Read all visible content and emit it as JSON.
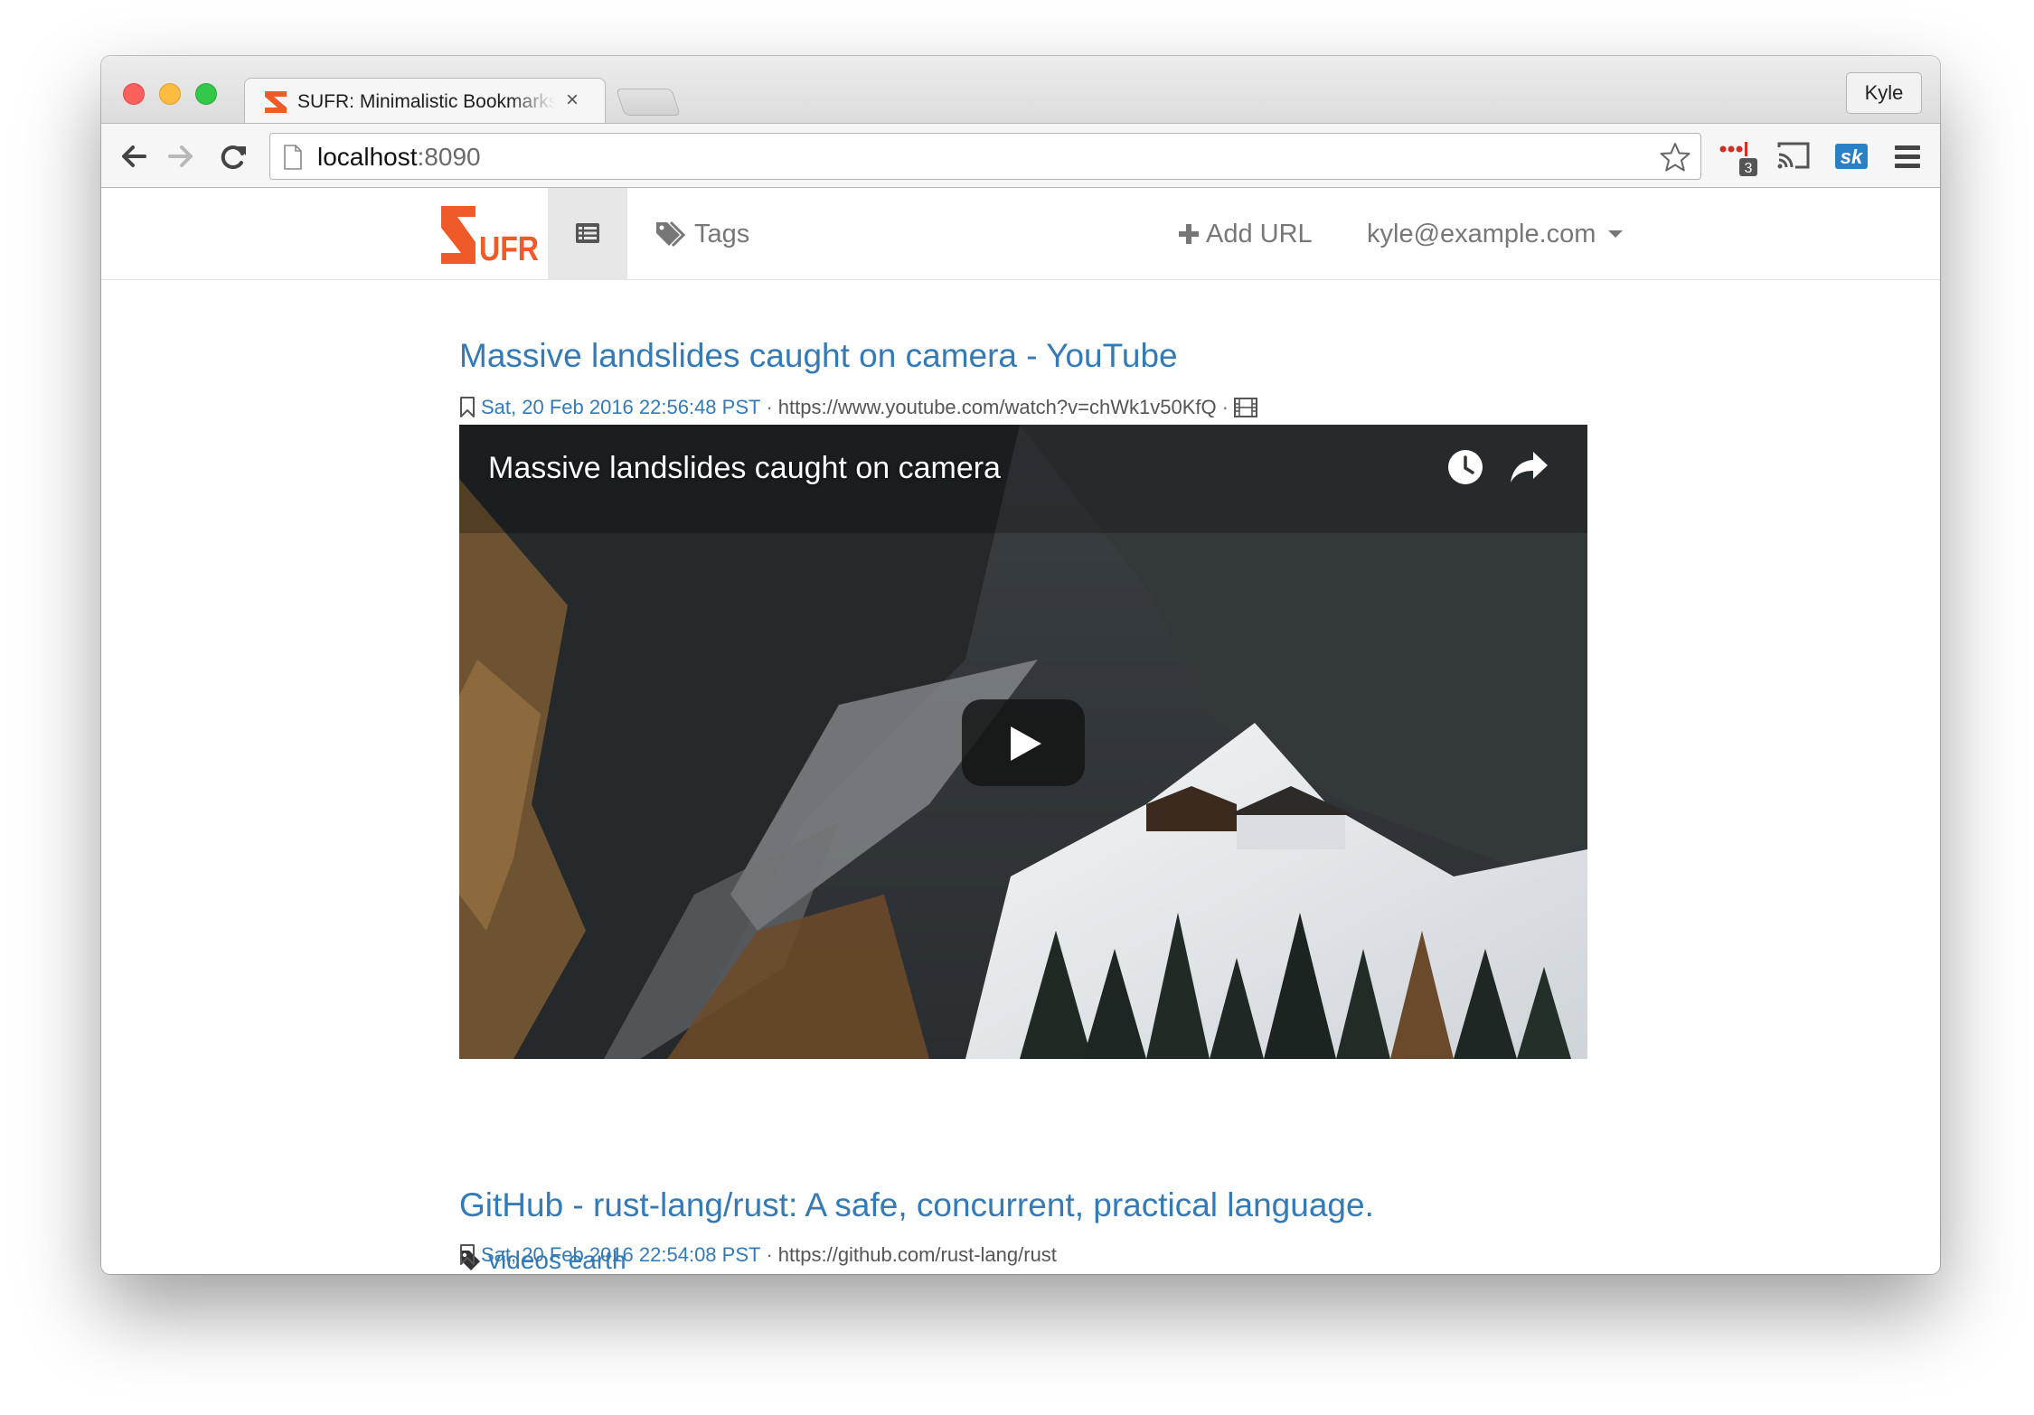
{
  "browser": {
    "tab_title": "SUFR: Minimalistic Bookmarks",
    "tab_close": "×",
    "profile_name": "Kyle",
    "url_host": "localhost",
    "url_port": ":8090",
    "extension_badge": "3"
  },
  "navbar": {
    "brand": "SUFR",
    "tags_label": "Tags",
    "add_url_label": "Add URL",
    "user_email": "kyle@example.com"
  },
  "bookmarks": [
    {
      "title": "Massive landslides caught on camera - YouTube",
      "date": "Sat, 20 Feb 2016 22:56:48 PST",
      "url": "https://www.youtube.com/watch?v=chWk1v50KfQ",
      "video_title": "Massive landslides caught on camera",
      "tags": "videos earth"
    },
    {
      "title": "GitHub - rust-lang/rust: A safe, concurrent, practical language.",
      "date": "Sat, 20 Feb 2016 22:54:08 PST",
      "url": "https://github.com/rust-lang/rust"
    }
  ],
  "colors": {
    "link": "#337ab7",
    "brand": "#f05a28"
  },
  "icons": {
    "back": "arrow-left-icon",
    "forward": "arrow-right-icon",
    "reload": "reload-icon",
    "star": "star-icon",
    "list": "list-icon",
    "tags": "tags-icon",
    "add": "plus-icon",
    "bookmark": "bookmark-icon",
    "film": "film-icon",
    "tag": "tag-icon",
    "watch_later": "clock-icon",
    "share": "share-icon",
    "play": "play-icon"
  }
}
